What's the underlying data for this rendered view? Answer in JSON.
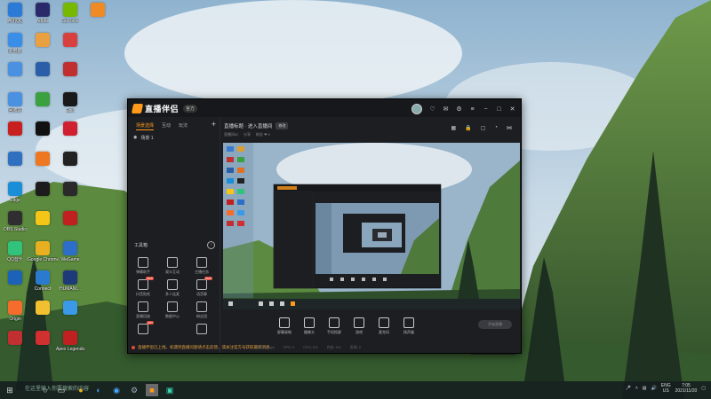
{
  "desktop_icons": [
    {
      "label": "腾讯QQ",
      "color": "#2b7bd6",
      "col": 0,
      "row": 0
    },
    {
      "label": "Adobe",
      "color": "#2a2a6a",
      "col": 1,
      "row": 0
    },
    {
      "label": "GeForce",
      "color": "#76b900",
      "col": 2,
      "row": 0
    },
    {
      "label": "",
      "color": "#f08a24",
      "col": 3,
      "row": 0
    },
    {
      "label": "此电脑",
      "color": "#3b8ee8",
      "col": 0,
      "row": 1
    },
    {
      "label": "",
      "color": "#e8a040",
      "col": 1,
      "row": 1
    },
    {
      "label": "",
      "color": "#d84040",
      "col": 2,
      "row": 1
    },
    {
      "label": "",
      "color": "#4b91e2",
      "col": 0,
      "row": 2
    },
    {
      "label": "",
      "color": "#2a5ea8",
      "col": 1,
      "row": 2
    },
    {
      "label": "",
      "color": "#c03030",
      "col": 2,
      "row": 2
    },
    {
      "label": "回收站",
      "color": "#4b91e2",
      "col": 0,
      "row": 3
    },
    {
      "label": "",
      "color": "#3aa040",
      "col": 1,
      "row": 3
    },
    {
      "label": "Epic",
      "color": "#1a1a1a",
      "col": 2,
      "row": 3
    },
    {
      "label": "",
      "color": "#c82020",
      "col": 0,
      "row": 4
    },
    {
      "label": "",
      "color": "#111111",
      "col": 1,
      "row": 4
    },
    {
      "label": "",
      "color": "#d02030",
      "col": 2,
      "row": 4
    },
    {
      "label": "",
      "color": "#3070c0",
      "col": 0,
      "row": 5
    },
    {
      "label": "",
      "color": "#ee7722",
      "col": 1,
      "row": 5
    },
    {
      "label": "",
      "color": "#222222",
      "col": 2,
      "row": 5
    },
    {
      "label": "Edge",
      "color": "#1a8fd8",
      "col": 0,
      "row": 6
    },
    {
      "label": "",
      "color": "#1c1c1c",
      "col": 1,
      "row": 6
    },
    {
      "label": "",
      "color": "#2a2a2a",
      "col": 2,
      "row": 6
    },
    {
      "label": "OBS Studio",
      "color": "#302e31",
      "col": 0,
      "row": 7
    },
    {
      "label": "",
      "color": "#f5c518",
      "col": 1,
      "row": 7
    },
    {
      "label": "",
      "color": "#c02020",
      "col": 2,
      "row": 7
    },
    {
      "label": "QQ音乐",
      "color": "#31c27c",
      "col": 0,
      "row": 8
    },
    {
      "label": "Google Chrome",
      "color": "#e8b020",
      "col": 1,
      "row": 8
    },
    {
      "label": "WeGame",
      "color": "#2d6ec8",
      "col": 2,
      "row": 8
    },
    {
      "label": "",
      "color": "#1c62b9",
      "col": 0,
      "row": 9
    },
    {
      "label": "Connect",
      "color": "#2a7ad0",
      "col": 1,
      "row": 9
    },
    {
      "label": "HUMANI...",
      "color": "#1e3a78",
      "col": 2,
      "row": 9
    },
    {
      "label": "Origin",
      "color": "#f56c2d",
      "col": 0,
      "row": 10
    },
    {
      "label": "",
      "color": "#f0c030",
      "col": 1,
      "row": 10
    },
    {
      "label": "",
      "color": "#3a9ae8",
      "col": 2,
      "row": 10
    },
    {
      "label": "",
      "color": "#c03030",
      "col": 0,
      "row": 11
    },
    {
      "label": "",
      "color": "#d03030",
      "col": 1,
      "row": 11
    },
    {
      "label": "Apex Legends",
      "color": "#c02020",
      "col": 2,
      "row": 11
    }
  ],
  "app": {
    "logo_text": "直播伴侣",
    "version_badge": "官方",
    "left_tabs": [
      "场景选择",
      "互动",
      "玩法"
    ],
    "scene_label": "场景 1",
    "tools_header": "工具箱",
    "tools": [
      {
        "label": "弹幕助手",
        "col": 0,
        "row": 0,
        "badge": ""
      },
      {
        "label": "观众互动",
        "col": 1,
        "row": 0,
        "badge": ""
      },
      {
        "label": "主播任务",
        "col": 2,
        "row": 0,
        "badge": ""
      },
      {
        "label": "抖音贴纸",
        "col": 0,
        "row": 1,
        "badge": "NEW"
      },
      {
        "label": "多人连麦",
        "col": 1,
        "row": 1,
        "badge": ""
      },
      {
        "label": "语音聊",
        "col": 2,
        "row": 1,
        "badge": "NEW"
      },
      {
        "label": "直播回放",
        "col": 0,
        "row": 2,
        "badge": ""
      },
      {
        "label": "数据中心",
        "col": 1,
        "row": 2,
        "badge": ""
      },
      {
        "label": "粉丝团",
        "col": 2,
        "row": 2,
        "badge": ""
      },
      {
        "label": "",
        "col": 0,
        "row": 3,
        "badge": "HOT"
      },
      {
        "label": "",
        "col": 2,
        "row": 3,
        "badge": ""
      }
    ],
    "notice": "直播伴侣已上线，如遇到直播问题请点击反馈，或关注官方号获取最新消息",
    "room_title": "直播标题 · 进入直播间",
    "edit_label": "修改",
    "room_info": [
      "直播间ID",
      "分享",
      "粉丝 ❤ 0"
    ],
    "controls": [
      {
        "label": "屏幕录制",
        "pos": 0
      },
      {
        "label": "摄像头",
        "pos": 1
      },
      {
        "label": "手机投屏",
        "pos": 2
      },
      {
        "label": "游戏",
        "pos": 3
      },
      {
        "label": "麦克风",
        "pos": 4
      },
      {
        "label": "扬声器",
        "pos": 5
      }
    ],
    "go_live_label": "开始直播",
    "stats": [
      "码率: 0kbps",
      "FPS: 0",
      "CPU: 0%",
      "内存: 0%",
      "丢帧: 0"
    ]
  },
  "taskbar": {
    "search_placeholder": "在这里输入你要搜索的内容",
    "lang": "ENG",
    "region": "US",
    "time": "7:05",
    "date": "2021/11/20"
  }
}
